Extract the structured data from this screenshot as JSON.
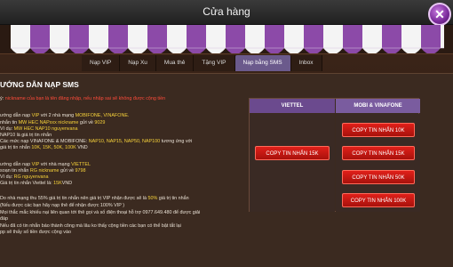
{
  "window": {
    "title": "Cửa hàng"
  },
  "tabs": [
    {
      "label": "Nạp VIP"
    },
    {
      "label": "Nạp Xu"
    },
    {
      "label": "Mua thẻ"
    },
    {
      "label": "Tặng VIP"
    },
    {
      "label": "Nạp bằng SMS"
    },
    {
      "label": "Inbox"
    }
  ],
  "content": {
    "heading": "ƯỚNG DẪN NẠP SMS",
    "lines": [
      {
        "pre": "ý: ",
        "red": "nickname của bạn là tên đăng nhập, nếu nhập sai sẽ không được cộng tiền",
        "post": ""
      },
      {
        "pre": "ướng dẫn nạp ",
        "yel": "VIP",
        "post": " với 2 nhà mạng ",
        "yel2": "MOBIFONE, VINAFONE."
      },
      {
        "pre": "nhắn tin ",
        "yel": "MW HEC NAPxxx nickname",
        "post": " gửi về ",
        "yel2": "9029"
      },
      {
        "pre": "Ví dụ: ",
        "yel": "MW HEC NAP10 nguyenvana",
        "post": "",
        "yel2": ""
      },
      {
        "pre": "NAP10",
        "yel": "",
        "post": " là giá trị tin nhắn",
        "yel2": ""
      },
      {
        "pre": "Các mức nạp VINAFONE & MOBIFONE: ",
        "yel": "NAP10, NAP15, NAP50, NAP100",
        "post": " tương ứng với",
        "yel2": ""
      },
      {
        "pre": "giá trị tin nhắn ",
        "yel": "10K, 15K, 50K, 100K",
        "post": " VND",
        "yel2": ""
      },
      {
        "pre": "ướng dẫn nạp ",
        "yel": "VIP",
        "post": " với nhà mạng ",
        "yel2": "VIETTEL"
      },
      {
        "pre": "soạn tin nhắn ",
        "yel": "RG nickname",
        "post": " gửi về ",
        "yel2": "9798"
      },
      {
        "pre": "Ví dụ: ",
        "yel": "RG nguyenvana",
        "post": "",
        "yel2": ""
      },
      {
        "pre": "Giá trị tin nhắn Viettel là: ",
        "yel": "15K",
        "post": "VND",
        "yel2": ""
      },
      {
        "pre": "Do nhà mạng thu 55% giá trị tin nhắn nên giá trị VIP nhận được sẽ là ",
        "yel": "50%",
        "post": " giá trị tin nhắn",
        "yel2": ""
      },
      {
        "pre": "(Nếu được các bạn hãy nạp thẻ để nhận được 100% VIP )",
        "yel": "",
        "post": "",
        "yel2": ""
      },
      {
        "pre": "Mọi thắc mắc khiếu nại liên quan tới thẻ gọi và số điện thoại hỗ trợ 0977.649.480 để được giải",
        "yel": "",
        "post": "",
        "yel2": ""
      },
      {
        "pre": "đáp",
        "yel": "",
        "post": "",
        "yel2": ""
      },
      {
        "pre": "Nếu đã có tin nhắn báo thành công mà lâu ko thấy cộng tiền các bạn có thể bật tắt lại",
        "yel": "",
        "post": "",
        "yel2": ""
      },
      {
        "pre": "pp sẽ thấy số tiền được cộng vào",
        "yel": "",
        "post": "",
        "yel2": ""
      }
    ]
  },
  "price_table": {
    "col_a_header": "VIETTEL",
    "col_b_header": "MOBI & VINAFONE",
    "viettel_buttons": [
      "COPY TIN NHẮN 15K"
    ],
    "mobi_buttons": [
      "COPY TIN NHẮN 10K",
      "COPY TIN NHẮN 15K",
      "COPY TIN NHẮN 50K",
      "COPY TIN NHẮN 100K"
    ]
  },
  "colors": {
    "accent_red": "#e0201a",
    "tab_active": "#6b5a8c",
    "highlight_yellow": "#f7d23a"
  }
}
